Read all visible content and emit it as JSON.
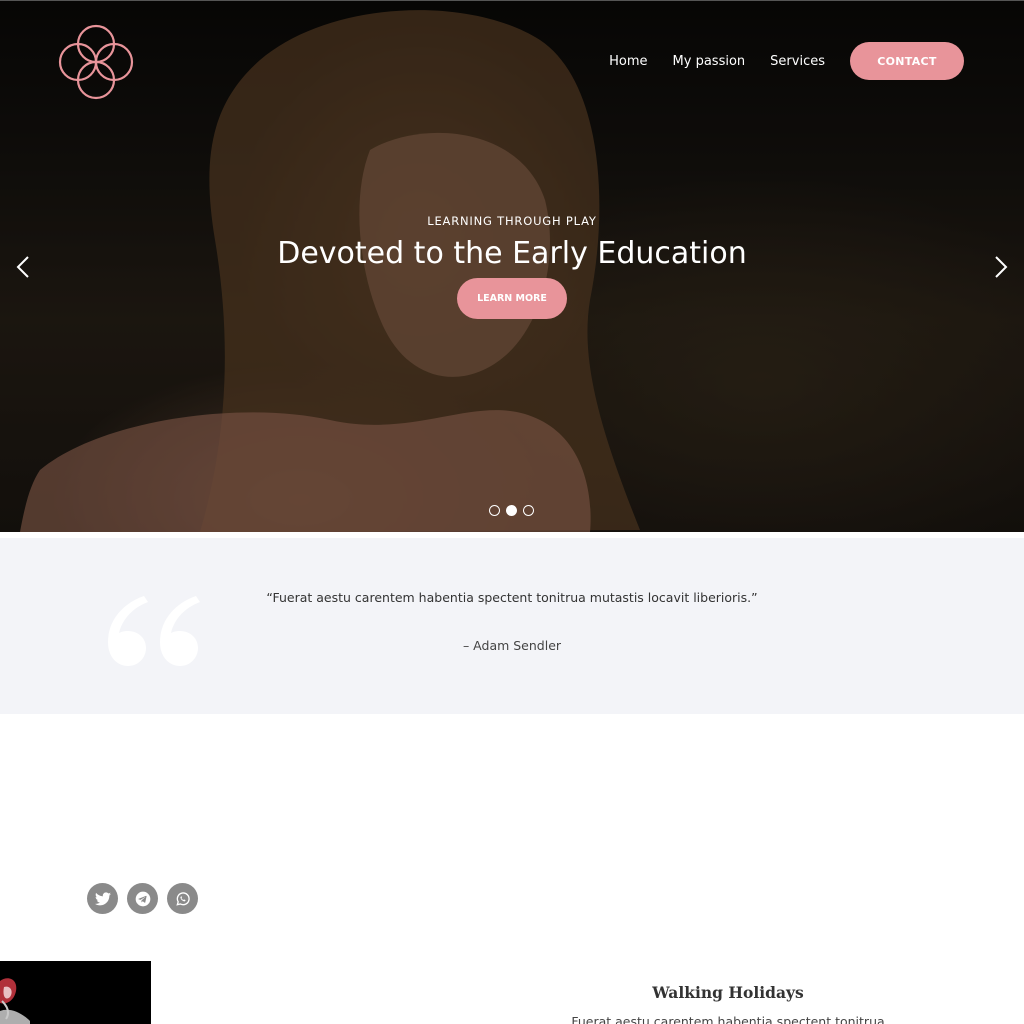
{
  "nav": {
    "links": [
      {
        "label": "Home"
      },
      {
        "label": "My passion"
      },
      {
        "label": "Services"
      }
    ],
    "contact_label": "CONTACT"
  },
  "hero": {
    "kicker": "LEARNING THROUGH PLAY",
    "title": "Devoted to the Early Education",
    "button_label": "LEARN MORE",
    "slides_total": 3,
    "active_slide": 2
  },
  "quote": {
    "text": "“Fuerat aestu carentem habentia spectent tonitrua mutastis locavit liberioris.”",
    "author": "– Adam Sendler"
  },
  "social": {
    "icons": [
      "twitter-icon",
      "telegram-icon",
      "whatsapp-icon"
    ]
  },
  "card": {
    "title": "Walking Holidays",
    "text": "Fuerat aestu carentem habentia spectent tonitrua"
  },
  "colors": {
    "accent": "#e8949a",
    "quote_band": "#f3f4f8",
    "social_icon_bg": "#8a8a8a"
  }
}
